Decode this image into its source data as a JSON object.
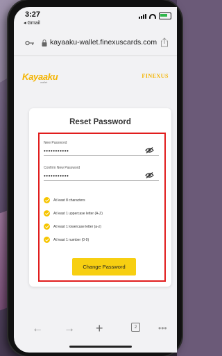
{
  "status_bar": {
    "time": "3:27",
    "back_app": "◂ Gmail"
  },
  "browser": {
    "url": "kayaaku-wallet.finexuscards.com",
    "tabs_count": "2"
  },
  "brand": {
    "logo_main": "Kayaaku",
    "logo_sub": "wallet",
    "partner_logo": "FINEXUS",
    "accent_color": "#f7cf11"
  },
  "form": {
    "title": "Reset Password",
    "new_password_label": "New Password",
    "new_password_value": "•••••••••••",
    "confirm_password_label": "Confirm New Password",
    "confirm_password_value": "•••••••••••",
    "requirements": [
      {
        "label": "At least 8 characters"
      },
      {
        "label": "At least 1 uppercase letter (A-Z)"
      },
      {
        "label": "At least 1 lowercase letter (a-z)"
      },
      {
        "label": "At least 1 number (0-9)"
      }
    ],
    "submit_label": "Change Password",
    "highlight_color": "#e11d1d"
  },
  "toolbar": {
    "back_icon": "arrow-left-icon",
    "forward_icon": "arrow-right-icon",
    "new_tab_icon": "plus-icon",
    "more_icon": "more-icon"
  }
}
